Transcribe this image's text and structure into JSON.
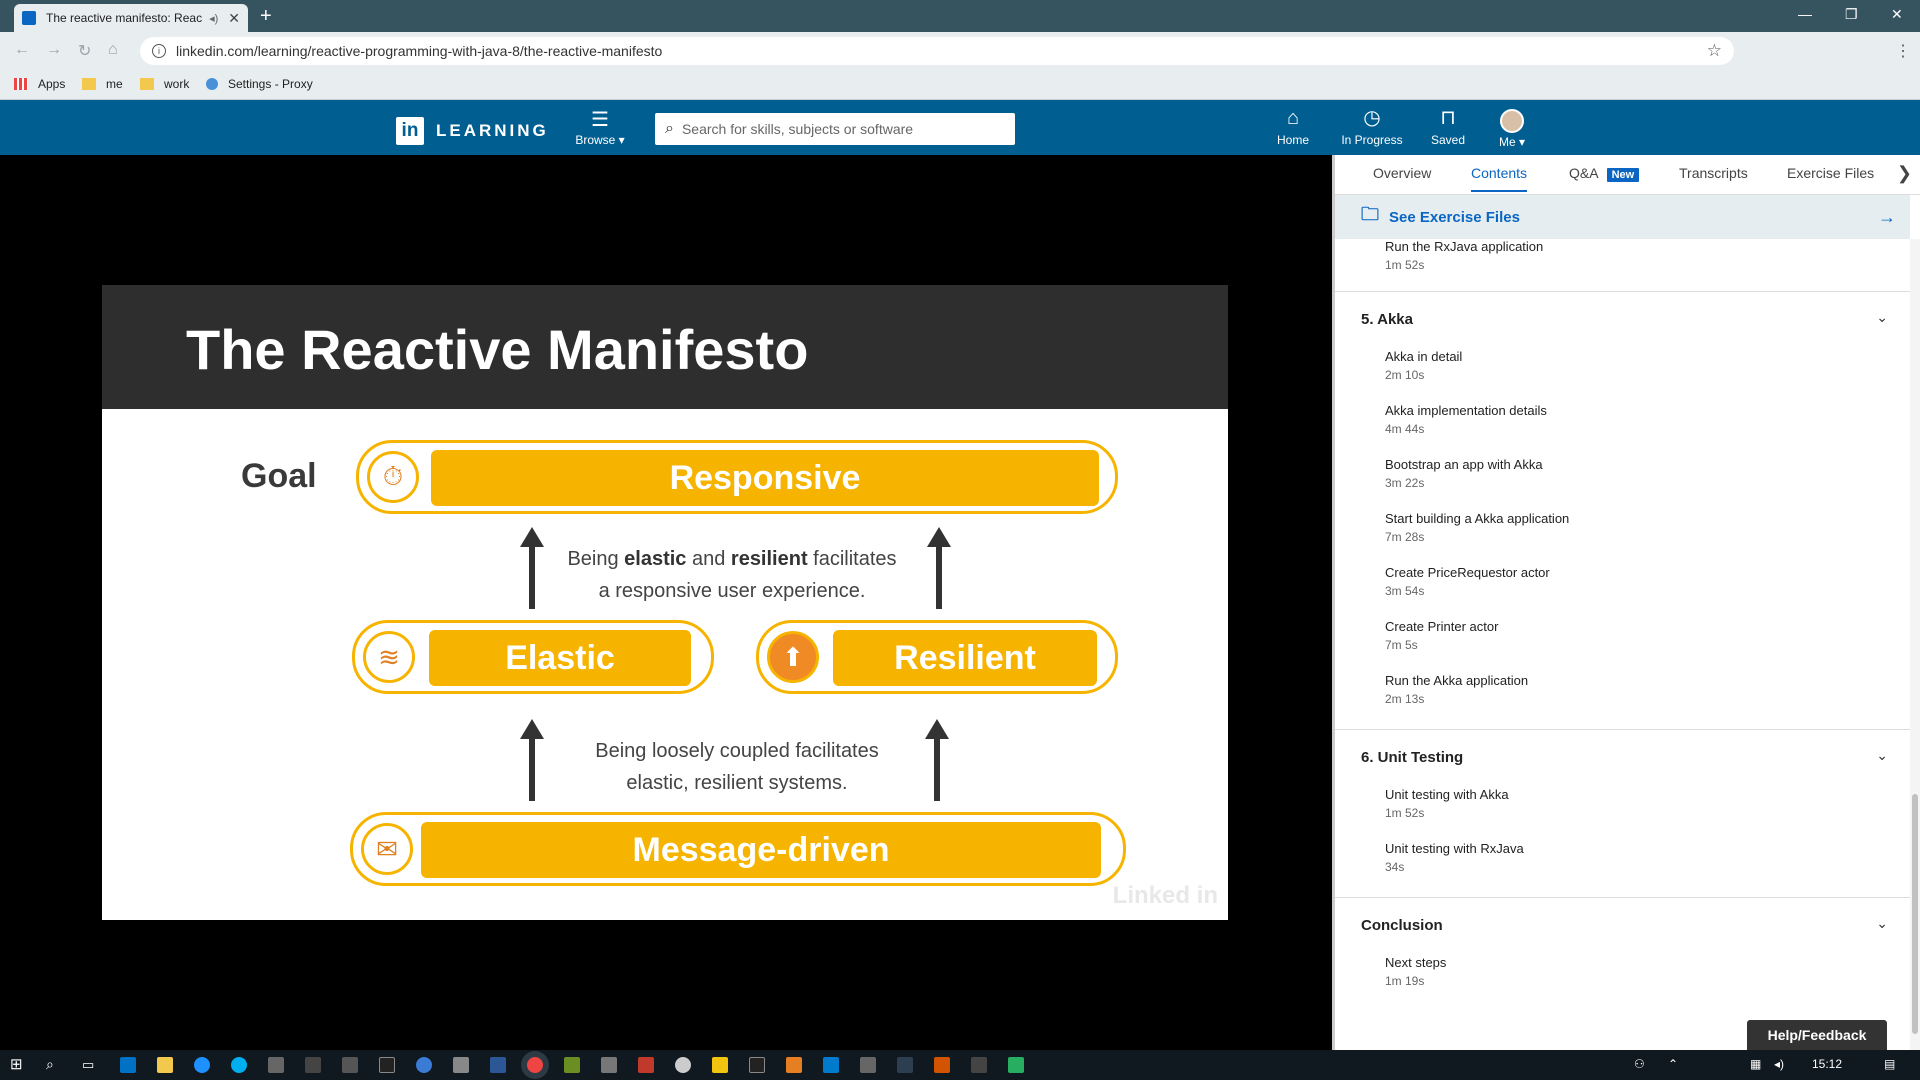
{
  "browser": {
    "tab_title": "The reactive manifesto: Reac",
    "url": "linkedin.com/learning/reactive-programming-with-java-8/the-reactive-manifesto",
    "bookmarks": [
      "Apps",
      "me",
      "work",
      "Settings - Proxy"
    ]
  },
  "header": {
    "logo_letters": "in",
    "logo_word": "LEARNING",
    "browse_label": "Browse ▾",
    "search_placeholder": "Search for skills, subjects or software",
    "nav": [
      {
        "label": "Home",
        "icon": "home-icon"
      },
      {
        "label": "In Progress",
        "icon": "clock-icon"
      },
      {
        "label": "Saved",
        "icon": "bookmark-icon"
      },
      {
        "label": "Me ▾",
        "icon": "avatar"
      }
    ]
  },
  "slide": {
    "title": "The Reactive Manifesto",
    "goal": "Goal",
    "responsive": "Responsive",
    "elastic": "Elastic",
    "resilient": "Resilient",
    "message_driven": "Message-driven",
    "caption1_a": "Being ",
    "caption1_b": "elastic",
    "caption1_c": " and ",
    "caption1_d": "resilient",
    "caption1_e": " facilitates",
    "caption1_f": "a responsive user experience.",
    "caption2_a": "Being loosely coupled facilitates",
    "caption2_b": "elastic, resilient systems.",
    "watermark": "Linked in"
  },
  "panel": {
    "tabs": [
      "Overview",
      "Contents",
      "Q&A",
      "Transcripts",
      "Exercise Files"
    ],
    "new_badge": "New",
    "exercise_link": "See Exercise Files",
    "prev_item": {
      "title": "Run the RxJava application",
      "duration": "1m 52s"
    },
    "sections": [
      {
        "title": "5. Akka",
        "items": [
          {
            "title": "Akka in detail",
            "duration": "2m 10s"
          },
          {
            "title": "Akka implementation details",
            "duration": "4m 44s"
          },
          {
            "title": "Bootstrap an app with Akka",
            "duration": "3m 22s"
          },
          {
            "title": "Start building a Akka application",
            "duration": "7m 28s"
          },
          {
            "title": "Create PriceRequestor actor",
            "duration": "3m 54s"
          },
          {
            "title": "Create Printer actor",
            "duration": "7m 5s"
          },
          {
            "title": "Run the Akka application",
            "duration": "2m 13s"
          }
        ]
      },
      {
        "title": "6. Unit Testing",
        "items": [
          {
            "title": "Unit testing with Akka",
            "duration": "1m 52s"
          },
          {
            "title": "Unit testing with RxJava",
            "duration": "34s"
          }
        ]
      },
      {
        "title": "Conclusion",
        "items": [
          {
            "title": "Next steps",
            "duration": "1m 19s"
          }
        ]
      }
    ],
    "help": "Help/Feedback"
  },
  "taskbar": {
    "clock": "15:12"
  },
  "colors": {
    "tabbar": "#35545f",
    "linkedin_blue": "#005e91",
    "accent_blue": "#0a66c2",
    "slide_yellow": "#f6b400"
  }
}
